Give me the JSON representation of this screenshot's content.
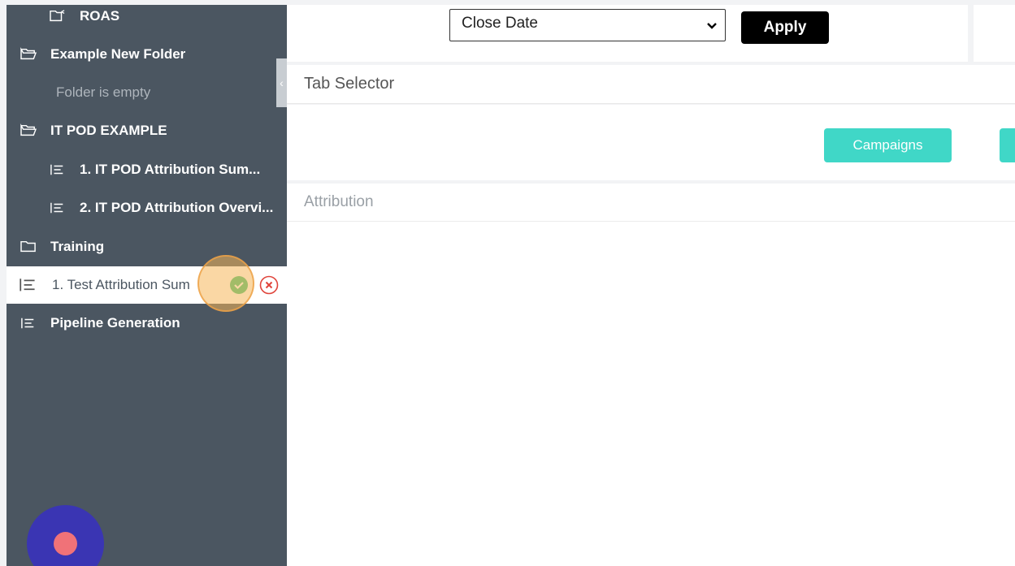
{
  "sidebar": {
    "items": [
      {
        "label": "ROAS",
        "icon": "folder-share-icon"
      },
      {
        "label": "Example New Folder",
        "icon": "folder-open-icon"
      },
      {
        "label": "Folder is empty"
      },
      {
        "label": "IT POD EXAMPLE",
        "icon": "folder-open-icon"
      },
      {
        "label": "1. IT POD Attribution Sum...",
        "icon": "report-icon"
      },
      {
        "label": "2. IT POD Attribution Overvi...",
        "icon": "report-icon"
      },
      {
        "label": "Training",
        "icon": "folder-icon"
      },
      {
        "label": "Pipeline Generation",
        "icon": "report-icon"
      }
    ],
    "editing": {
      "value": "1. Test Attribution Sum"
    }
  },
  "filter": {
    "select_value": "Close Date",
    "apply_label": "Apply"
  },
  "tab_selector": {
    "title": "Tab Selector",
    "buttons": [
      "Campaigns"
    ]
  },
  "attribution": {
    "title": "Attribution"
  },
  "colors": {
    "sidebar": "#4b5661",
    "teal": "#40d7c7",
    "record": "#3a35b3",
    "record_dot": "#f07278"
  }
}
